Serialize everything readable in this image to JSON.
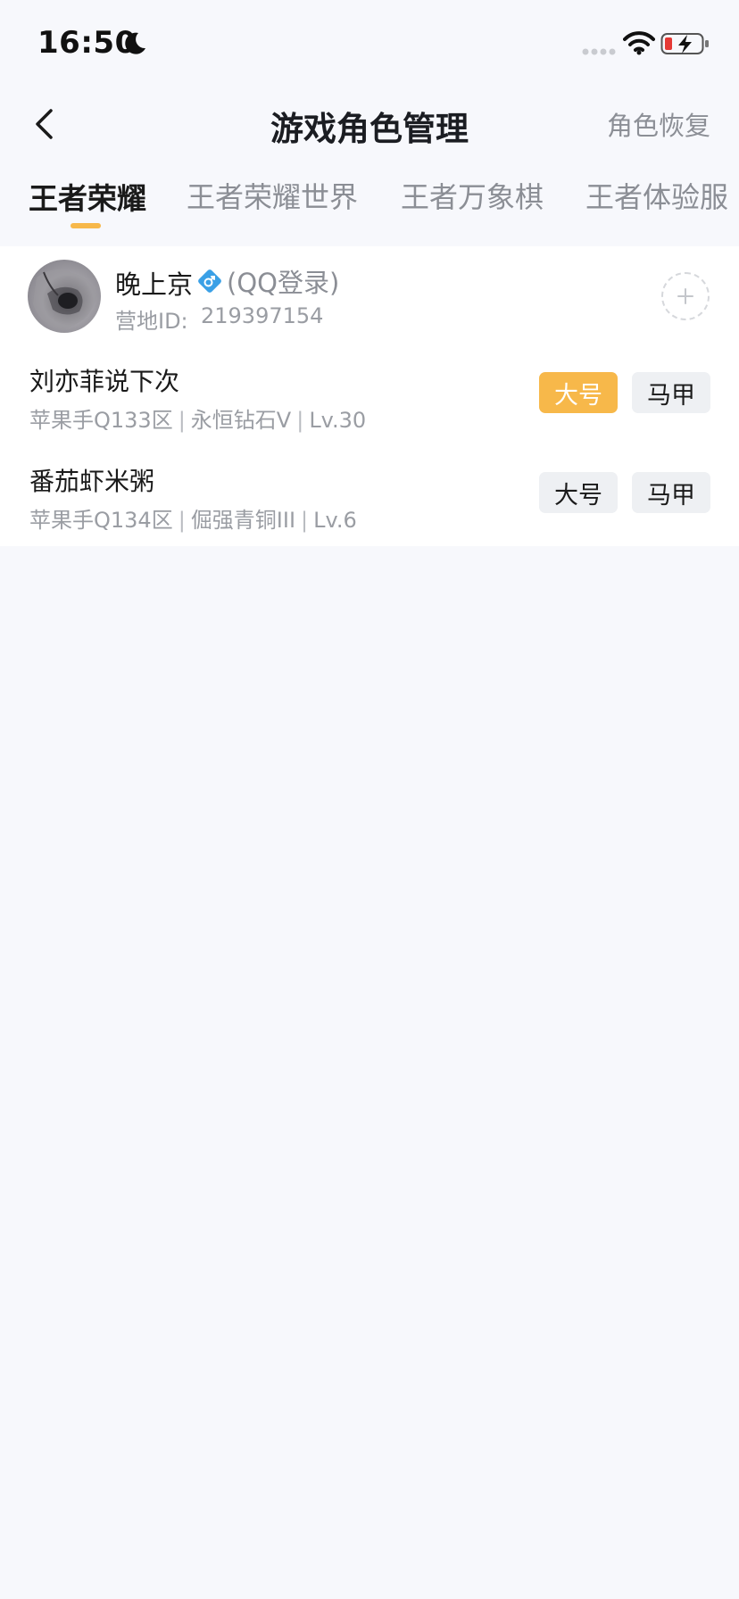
{
  "status_bar": {
    "time": "16:50"
  },
  "header": {
    "title": "游戏角色管理",
    "restore_label": "角色恢复"
  },
  "tabs": [
    {
      "label": "王者荣耀",
      "active": true
    },
    {
      "label": "王者荣耀世界",
      "active": false
    },
    {
      "label": "王者万象棋",
      "active": false
    },
    {
      "label": "王者体验服",
      "active": false
    }
  ],
  "account": {
    "name": "晚上京",
    "login_type": "(QQ登录)",
    "camp_id_label": "营地ID:",
    "camp_id": "219397154"
  },
  "roles": [
    {
      "name": "刘亦菲说下次",
      "server": "苹果手Q133区",
      "rank": "永恒钻石V",
      "level": "Lv.30",
      "main_tag": "大号",
      "alt_tag": "马甲",
      "selected_tag": "main"
    },
    {
      "name": "番茄虾米粥",
      "server": "苹果手Q134区",
      "rank": "倔强青铜III",
      "level": "Lv.6",
      "main_tag": "大号",
      "alt_tag": "马甲",
      "selected_tag": "none"
    }
  ],
  "colors": {
    "accent": "#f7b84a",
    "background": "#f7f8fc",
    "card": "#ffffff",
    "male_icon": "#3aa0e6"
  }
}
